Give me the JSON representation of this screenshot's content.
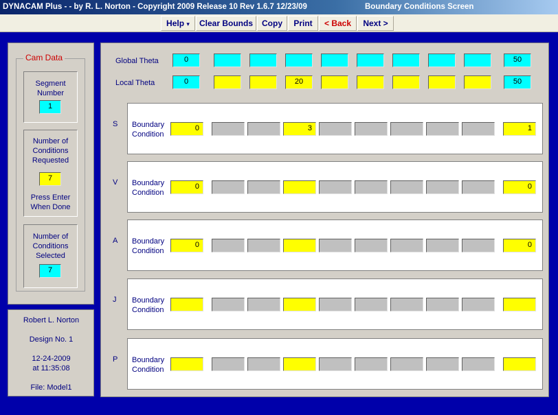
{
  "window": {
    "title": "DYNACAM Plus -  - by R. L. Norton - Copyright 2009 Release 10  Rev 1.6.7  12/23/09",
    "screen_name": "Boundary Conditions Screen"
  },
  "toolbar": {
    "help": "Help",
    "help_arrow": "▾",
    "clear_bounds": "Clear Bounds",
    "copy": "Copy",
    "print": "Print",
    "back": "< Back",
    "next": "Next >"
  },
  "cam_data": {
    "legend": "Cam Data",
    "segment_label": [
      "Segment",
      "Number"
    ],
    "segment_value": "1",
    "requested_label": [
      "Number of",
      "Conditions",
      "Requested"
    ],
    "requested_value": "7",
    "press_enter": [
      "Press Enter",
      "When Done"
    ],
    "selected_label": [
      "Number of",
      "Conditions",
      "Selected"
    ],
    "selected_value": "7"
  },
  "info": {
    "author": "Robert L. Norton",
    "design": "Design No. 1",
    "date": "12-24-2009",
    "time": "at 11:35:08",
    "file": "File: Model1"
  },
  "theta": {
    "global_label": "Global Theta",
    "local_label": "Local Theta",
    "global": [
      "0",
      "",
      "",
      "",
      "",
      "",
      "",
      "",
      "",
      "50"
    ],
    "local": [
      "0",
      "",
      "",
      "20",
      "",
      "",
      "",
      "",
      "",
      "50"
    ]
  },
  "bc_label": [
    "Boundary",
    "Condition"
  ],
  "rows": [
    {
      "letter": "S",
      "values": [
        "0",
        "",
        "",
        "3",
        "",
        "",
        "",
        "",
        "",
        "1"
      ]
    },
    {
      "letter": "V",
      "values": [
        "0",
        "",
        "",
        "",
        "",
        "",
        "",
        "",
        "",
        "0"
      ]
    },
    {
      "letter": "A",
      "values": [
        "0",
        "",
        "",
        "",
        "",
        "",
        "",
        "",
        "",
        "0"
      ]
    },
    {
      "letter": "J",
      "values": [
        "",
        "",
        "",
        "",
        "",
        "",
        "",
        "",
        "",
        ""
      ]
    },
    {
      "letter": "P",
      "values": [
        "",
        "",
        "",
        "",
        "",
        "",
        "",
        "",
        "",
        ""
      ]
    }
  ],
  "colors": {
    "background": "#0000aa",
    "cyan": "#00ffff",
    "yellow": "#ffff00",
    "gray": "#c0c0c0",
    "label": "#000080"
  }
}
